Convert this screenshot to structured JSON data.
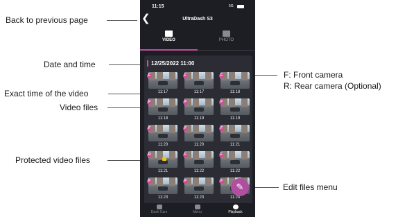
{
  "status_bar": {
    "time": "11:15",
    "network": "5G"
  },
  "header": {
    "title": "UltraDash S3",
    "back_icon": "chevron-left-icon"
  },
  "tabs": [
    {
      "label": "VIDEO",
      "icon": "video-icon",
      "active": true
    },
    {
      "label": "PHOTO",
      "icon": "photo-icon",
      "active": false
    }
  ],
  "date_header": "12/25/2022 11:00",
  "videos": [
    {
      "time": "11:17",
      "camera": "F",
      "protected": false
    },
    {
      "time": "11:17",
      "camera": "F",
      "protected": false
    },
    {
      "time": "11:18",
      "camera": "F",
      "protected": false
    },
    {
      "time": "11:18",
      "camera": "F",
      "protected": false
    },
    {
      "time": "11:19",
      "camera": "F",
      "protected": false
    },
    {
      "time": "11:19",
      "camera": "F",
      "protected": false
    },
    {
      "time": "11:20",
      "camera": "F",
      "protected": false
    },
    {
      "time": "11:20",
      "camera": "F",
      "protected": false
    },
    {
      "time": "11:21",
      "camera": "F",
      "protected": false
    },
    {
      "time": "11:21",
      "camera": "R",
      "protected": true
    },
    {
      "time": "11:22",
      "camera": "F",
      "protected": false
    },
    {
      "time": "11:22",
      "camera": "F",
      "protected": false
    },
    {
      "time": "11:23",
      "camera": "F",
      "protected": false
    },
    {
      "time": "11:23",
      "camera": "F",
      "protected": false
    },
    {
      "time": "11:24",
      "camera": "F",
      "protected": false
    }
  ],
  "edit_button_icon": "pencil-icon",
  "bottom_nav": [
    {
      "label": "Dash Cam",
      "icon": "dashcam-icon"
    },
    {
      "label": "Menu",
      "icon": "gear-icon"
    },
    {
      "label": "Playback",
      "icon": "play-icon",
      "active": true
    }
  ],
  "annotations": {
    "back": "Back to previous page",
    "date_time": "Date and time",
    "exact_time": "Exact time of the video",
    "video_files": "Video files",
    "protected": "Protected video files",
    "camera_front": "F: Front camera",
    "camera_rear": "R: Rear camera (Optional)",
    "edit_menu": "Edit files menu"
  },
  "colors": {
    "accent": "#c34ca0",
    "background": "#1d1e23",
    "panel": "#2c2d34",
    "lock": "#f0c21a"
  }
}
